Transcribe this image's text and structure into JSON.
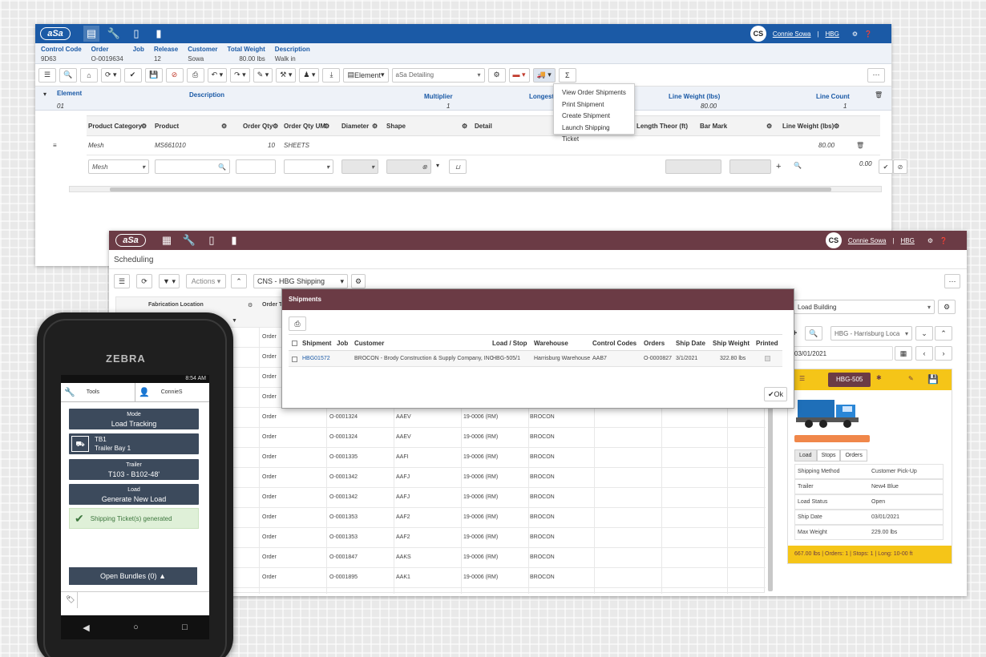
{
  "top_window": {
    "user": {
      "initials": "CS",
      "name": "Connie Sowa",
      "sep": "|",
      "location": "HBG"
    },
    "header": {
      "columns": [
        {
          "label": "Control Code",
          "value": "9D63"
        },
        {
          "label": "Order",
          "value": "O-0019634"
        },
        {
          "label": "Job",
          "value": ""
        },
        {
          "label": "Release",
          "value": "12"
        },
        {
          "label": "Customer",
          "value": "Sowa"
        },
        {
          "label": "Total Weight",
          "value": "80.00 lbs"
        },
        {
          "label": "Description",
          "value": "Walk in"
        }
      ]
    },
    "toolbar": {
      "element_label": "Element",
      "detailing_select": "aSa Detailing"
    },
    "element_row": {
      "h_element": "Element",
      "h_description": "Description",
      "h_multiplier": "Multiplier",
      "h_longest": "Longest",
      "h_line_weight": "Line Weight (lbs)",
      "h_line_count": "Line Count",
      "v_element": "01",
      "v_multiplier": "1",
      "v_line_weight": "80.00",
      "v_line_count": "1"
    },
    "detail_table": {
      "headers": {
        "product_category": "Product Category",
        "product": "Product",
        "order_qty": "Order Qty",
        "order_qty_um": "Order Qty UM",
        "diameter": "Diameter",
        "shape": "Shape",
        "detail": "Detail",
        "length_theor": "Length Theor (ft)",
        "bar_mark": "Bar Mark",
        "line_weight": "Line Weight (lbs)"
      },
      "row": {
        "product_category": "Mesh",
        "product": "MS661010",
        "order_qty": "10",
        "order_qty_um": "SHEETS",
        "line_weight": "80.00"
      },
      "input_row": {
        "product_category": "Mesh",
        "line_weight": "0.00"
      }
    },
    "shipment_menu": [
      "View Order Shipments",
      "Print Shipment",
      "Create Shipment",
      "Launch Shipping Ticket"
    ]
  },
  "scheduling_window": {
    "user": {
      "initials": "CS",
      "name": "Connie Sowa",
      "sep": "|",
      "location": "HBG"
    },
    "title": "Scheduling",
    "toolbar": {
      "actions": "Actions",
      "location_select": "CNS - HBG Shipping"
    },
    "grid": {
      "h_location": "Fabrication Location",
      "h_order": "Order T",
      "rows": [
        {
          "type": "Order",
          "order": "",
          "code": "",
          "job": "",
          "customer": ""
        },
        {
          "type": "Order",
          "order": "",
          "code": "",
          "job": "",
          "customer": ""
        },
        {
          "type": "Order",
          "order": "",
          "code": "",
          "job": "",
          "customer": ""
        },
        {
          "type": "Order",
          "order": "",
          "code": "",
          "job": "",
          "customer": ""
        },
        {
          "type": "Order",
          "order": "O-0001324",
          "code": "AAEV",
          "job": "19-0006 (RM)",
          "customer": "BROCON"
        },
        {
          "type": "Order",
          "order": "O-0001324",
          "code": "AAEV",
          "job": "19-0006 (RM)",
          "customer": "BROCON"
        },
        {
          "type": "Order",
          "order": "O-0001335",
          "code": "AAFI",
          "job": "19-0006 (RM)",
          "customer": "BROCON"
        },
        {
          "type": "Order",
          "order": "O-0001342",
          "code": "AAFJ",
          "job": "19-0006 (RM)",
          "customer": "BROCON"
        },
        {
          "type": "Order",
          "order": "O-0001342",
          "code": "AAFJ",
          "job": "19-0006 (RM)",
          "customer": "BROCON"
        },
        {
          "type": "Order",
          "order": "O-0001353",
          "code": "AAF2",
          "job": "19-0006 (RM)",
          "customer": "BROCON"
        },
        {
          "type": "Order",
          "order": "O-0001353",
          "code": "AAF2",
          "job": "19-0006 (RM)",
          "customer": "BROCON"
        },
        {
          "type": "Order",
          "order": "O-0001847",
          "code": "AAKS",
          "job": "19-0006 (RM)",
          "customer": "BROCON"
        },
        {
          "type": "Order",
          "order": "O-0001895",
          "code": "AAK1",
          "job": "19-0006 (RM)",
          "customer": "BROCON"
        }
      ]
    },
    "right_panel": {
      "load_select": "Load Building",
      "location_select": "HBG - Harrisburg Loca",
      "date": "03/01/2021",
      "load_id": "HBG-505",
      "tabs": [
        "Load",
        "Stops",
        "Orders"
      ],
      "info": [
        {
          "k": "Shipping Method",
          "v": "Customer Pick-Up"
        },
        {
          "k": "Trailer",
          "v": "New4 Blue"
        },
        {
          "k": "Load Status",
          "v": "Open"
        },
        {
          "k": "Ship Date",
          "v": "03/01/2021"
        },
        {
          "k": "Max Weight",
          "v": "229.00  lbs"
        }
      ],
      "summary": "667.00 lbs | Orders: 1 | Stops: 1 | Long: 10-00 ft"
    }
  },
  "shipments_modal": {
    "title": "Shipments",
    "headers": [
      "Shipment",
      "Job",
      "Customer",
      "Load / Stop",
      "Warehouse",
      "Control Codes",
      "Orders",
      "Ship Date",
      "Ship Weight",
      "Printed"
    ],
    "row": {
      "shipment": "HBG01572",
      "job": "",
      "customer": "BROCON - Brody Construction & Supply Company, INC",
      "load_stop": "HBG-505/1",
      "warehouse": "Harrisburg Warehouse",
      "control_codes": "AAB7",
      "orders": "O-0000827",
      "ship_date": "3/1/2021",
      "ship_weight": "322.80 lbs"
    },
    "ok_label": "Ok"
  },
  "phone": {
    "brand": "ZEBRA",
    "time": "8:54 AM",
    "tab_tools": "Tools",
    "tab_user": "ConnieS",
    "mode": {
      "label": "Mode",
      "value": "Load Tracking"
    },
    "bay": {
      "label": "TB1",
      "value": "Trailer Bay 1"
    },
    "trailer": {
      "label": "Trailer",
      "value": "T103 - B102-48'"
    },
    "load": {
      "label": "Load",
      "value": "Generate New Load"
    },
    "success": "Shipping Ticket(s) generated",
    "open_bundles": "Open Bundles (0)"
  },
  "colors": {
    "top_bar": "#1b5aa6",
    "sched_bar": "#6b3b45",
    "accent_yellow": "#f5c518",
    "phone_button": "#3c4a5c"
  }
}
